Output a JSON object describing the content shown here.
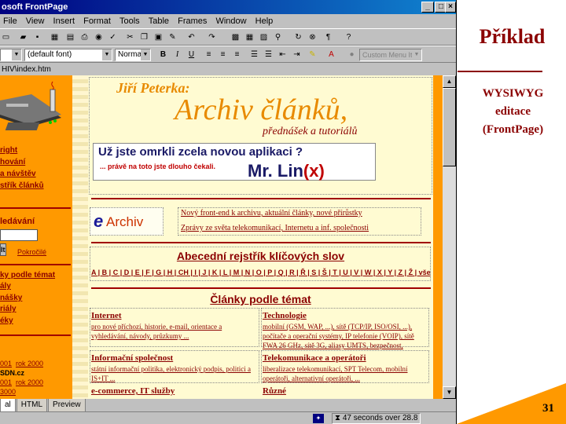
{
  "window": {
    "title": "osoft FrontPage",
    "menus": [
      "File",
      "View",
      "Insert",
      "Format",
      "Tools",
      "Table",
      "Frames",
      "Window",
      "Help"
    ],
    "font_select": "(default font)",
    "style_select": "Normal",
    "menu_item_select": "Custom Menu Item",
    "path": "HIV\\index.htm",
    "tabs": [
      "al",
      "HTML",
      "Preview"
    ],
    "status": "47 seconds over 28.8"
  },
  "page": {
    "author": "Jiří Peterka:",
    "title": "Archiv článků,",
    "subtitle": "přednášek a tutoriálů",
    "banner_line1": "Už jste omrkli zcela novou aplikaci ?",
    "banner_line2": "... právě na toto jste dlouho čekali.",
    "banner_brand": "Mr. Lin",
    "banner_brand_x": "(x)",
    "earchiv_e": "e",
    "earchiv_rest": "Archiv",
    "earchiv_link1": "Nový front-end k archivu, aktuální články, nové přírůstky",
    "earchiv_link2": "Zprávy ze světa telekomunikací, Internetu a inf. společnosti",
    "index_title": "Abecední rejstřík klíčových slov",
    "index_letters": "A | B | C | D | E | F | G | H | CH | I | J | K | L | M | N | O | P | Q | R | Ř | S | Š | T | U | V | W | X | Y | Z | Ž | vše",
    "topics_title": "Články podle témat",
    "topics": [
      {
        "title": "Internet",
        "body": "pro nové příchozí, historie, e-mail, orientace a vyhledávání, návody, průzkumy ..."
      },
      {
        "title": "Technologie",
        "body": "mobilní (GSM, WAP, ...), sítě (TCP/IP, ISO/OSI, ...), počítače a operační systémy, IP telefonie (VOIP), sítě FWA 26 GHz, sítě 3G, aliasy UMTS, bezpečnost,"
      },
      {
        "title": "Informační společnost",
        "body": "státní informační politika, elektronický podpis, politici a IS+IT ..."
      },
      {
        "title": "Telekomunikace a operátoři",
        "body": "liberalizace telekomunikací, SPT Telecom, mobilní operátoři, alternativní operátoři, ..."
      },
      {
        "title": "e-commerce, IT služby",
        "body": ""
      },
      {
        "title": "Různé",
        "body": ""
      }
    ]
  },
  "nav": {
    "links": [
      "right",
      "hování",
      "a návštěv",
      "střík článků"
    ],
    "search_title": "ledávání",
    "search_btn": "lt",
    "advanced": "Pokročilé",
    "topics": [
      "ky podle témat",
      "ály",
      "nášky",
      "riály",
      "éky"
    ],
    "years": [
      "001",
      "rok 2000",
      "SDN.cz",
      "001",
      "rok 2000",
      "3000"
    ]
  },
  "slide": {
    "title": "Příklad",
    "subtitle_lines": [
      "WYSIWYG",
      "editace",
      "(FrontPage)"
    ],
    "page_number": "31"
  },
  "colors": {
    "accent": "#ff9900",
    "dark_red": "#8b0000",
    "titlebar": "#000080"
  }
}
